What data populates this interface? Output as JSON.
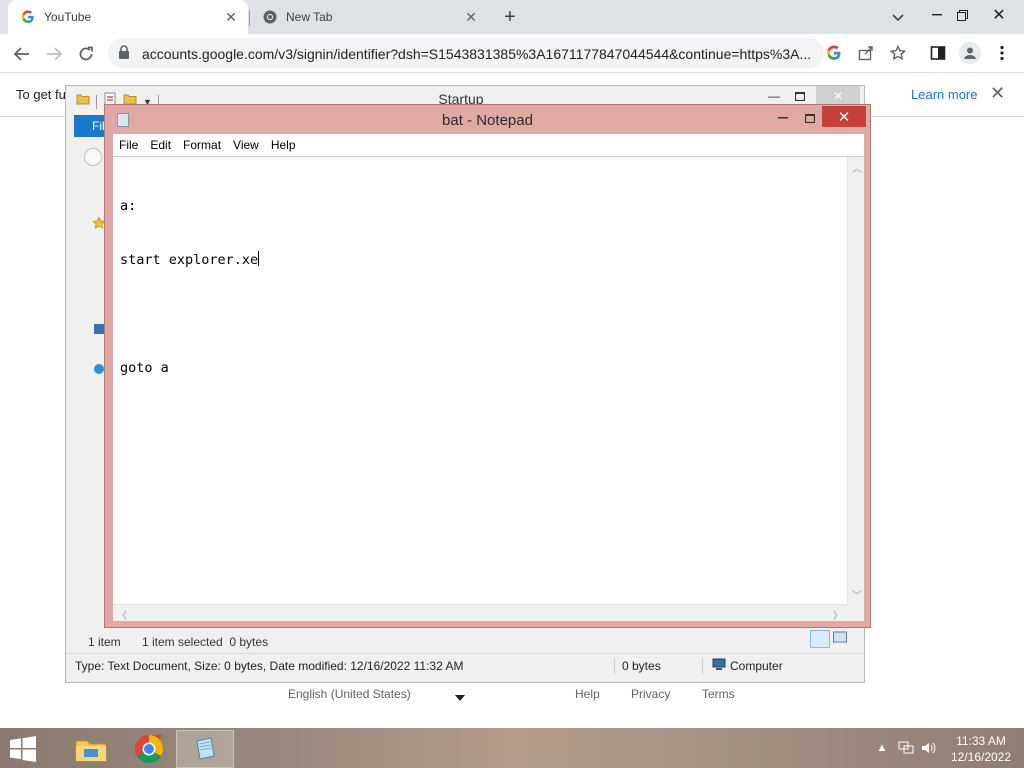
{
  "browser": {
    "tabs": [
      {
        "title": "YouTube",
        "icon": "google-g-icon",
        "active": true
      },
      {
        "title": "New Tab",
        "icon": "chrome-icon",
        "active": false
      }
    ],
    "new_tab_label": "+",
    "url": "accounts.google.com/v3/signin/identifier?dsh=S1543831385%3A1671177847044544&continue=https%3A..."
  },
  "google_page": {
    "infobar_message": "To get fu",
    "learn_more": "Learn more",
    "footer": {
      "language": "English (United States)",
      "help": "Help",
      "privacy": "Privacy",
      "terms": "Terms"
    }
  },
  "explorer": {
    "title": "Startup",
    "ribbon_file": "Fil",
    "status_items": "1 item",
    "status_selected": "1 item selected  0 bytes",
    "details": "Type: Text Document, Size: 0 bytes, Date modified: 12/16/2022 11:32 AM",
    "size": "0 bytes",
    "location": "Computer"
  },
  "notepad": {
    "title": "bat - Notepad",
    "menu": [
      "File",
      "Edit",
      "Format",
      "View",
      "Help"
    ],
    "lines": [
      "a:",
      "start explorer.xe",
      "",
      "goto a"
    ]
  },
  "taskbar": {
    "time": "11:33 AM",
    "date": "12/16/2022",
    "apps": [
      "file-explorer-icon",
      "chrome-icon",
      "notepad-icon"
    ]
  },
  "colors": {
    "notepad_frame": "#e1a9a3",
    "close_red": "#c7403a",
    "chrome_tabstrip": "#dee1e6",
    "link_blue": "#1a73e8"
  }
}
